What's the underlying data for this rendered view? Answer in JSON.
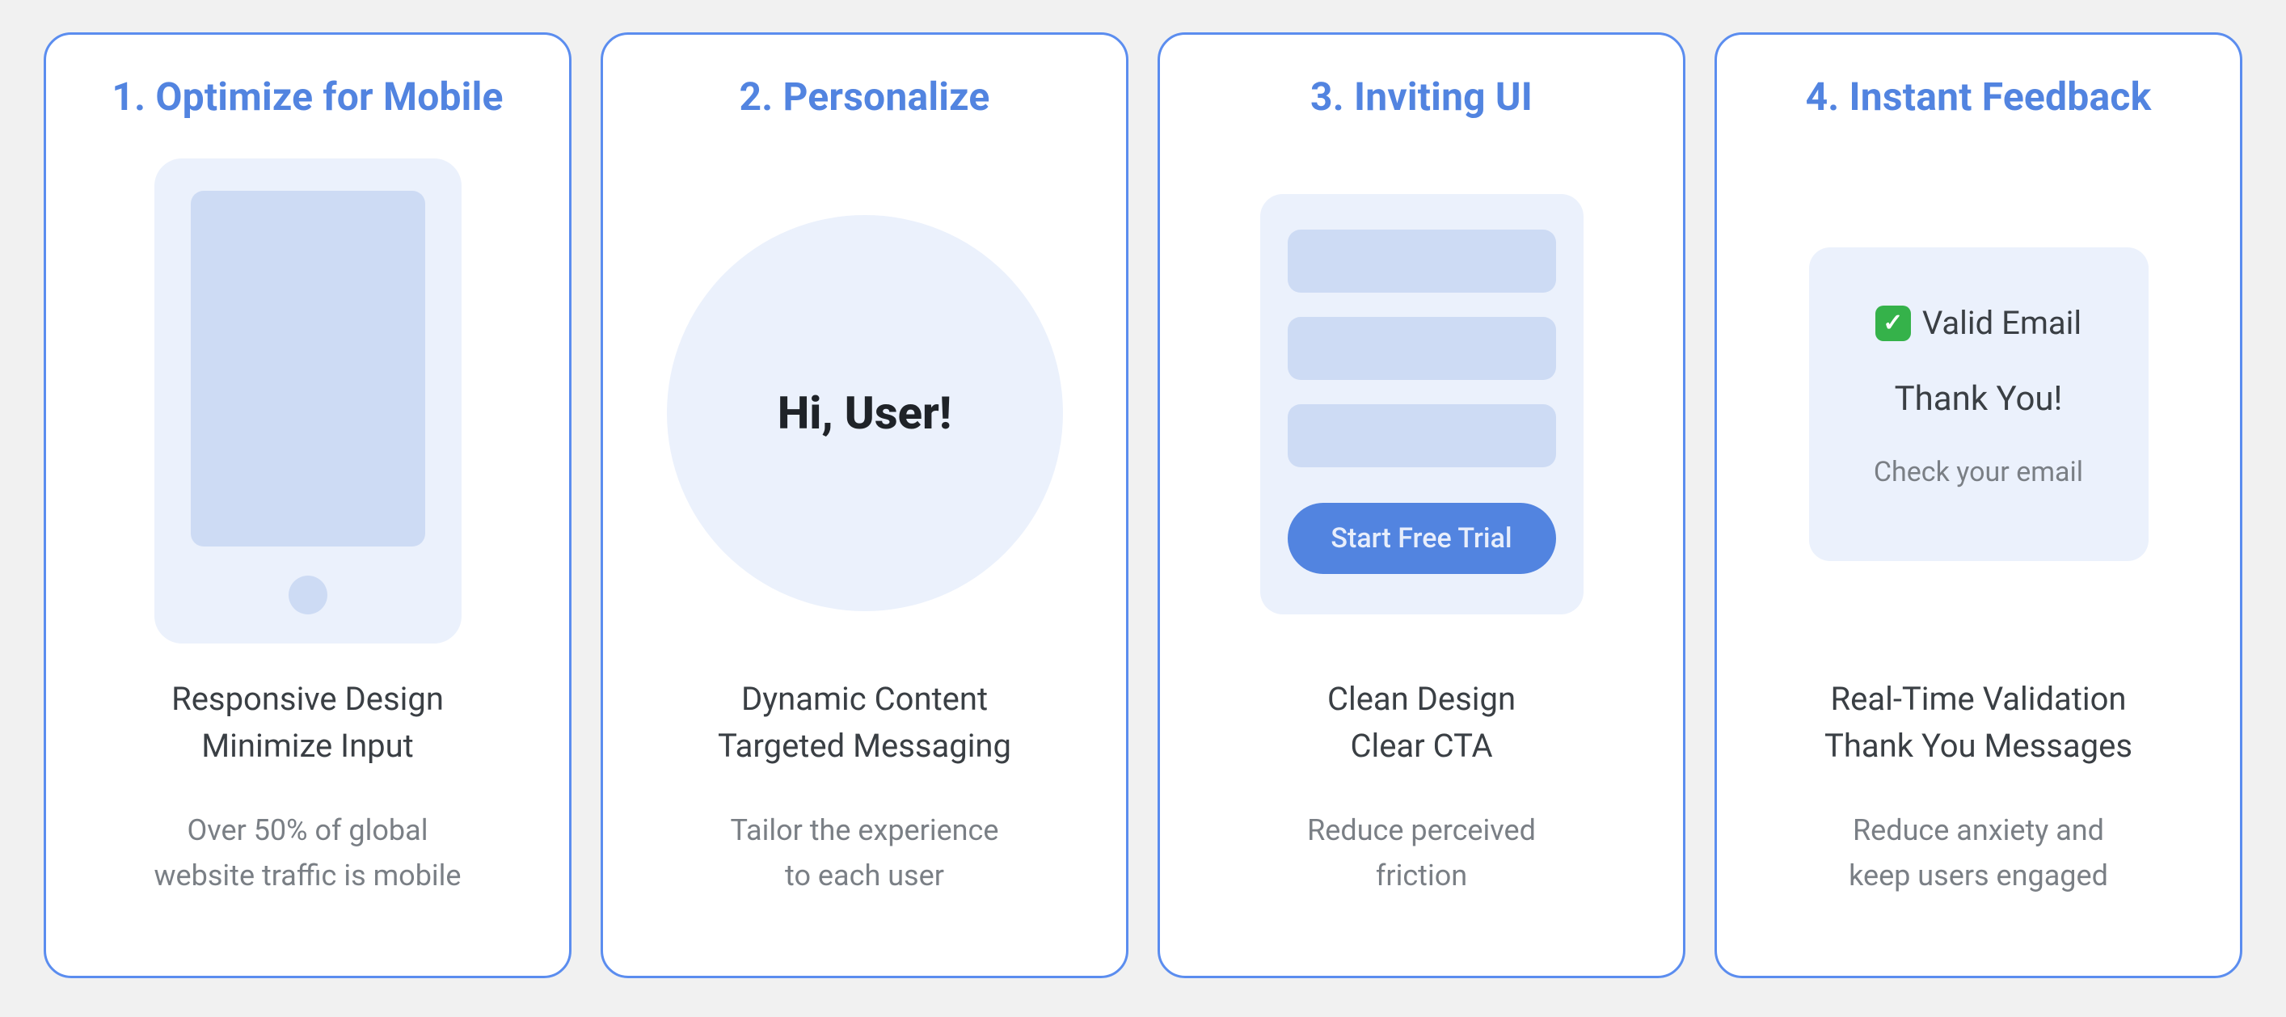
{
  "colors": {
    "bg": "#f1f1f1",
    "card_bg": "#ffffff",
    "card_border": "#5b8def",
    "title": "#5284e0",
    "soft": "#ebf1fc",
    "soft2": "#cddbf4",
    "accent": "#5284e0",
    "subtext": "#7a7f85",
    "ink": "#2b2f33",
    "check_bg": "#35b24a"
  },
  "cards": [
    {
      "title": "1. Optimize for Mobile",
      "bullet1": "Responsive Design",
      "bullet2": "Minimize Input",
      "caption1": "Over 50% of global",
      "caption2": "website traffic is mobile"
    },
    {
      "title": "2. Personalize",
      "greeting": "Hi, User!",
      "bullet1": "Dynamic Content",
      "bullet2": "Targeted Messaging",
      "caption1": "Tailor the experience",
      "caption2": "to each user"
    },
    {
      "title": "3. Inviting UI",
      "cta_label": "Start Free Trial",
      "bullet1": "Clean Design",
      "bullet2": "Clear CTA",
      "caption1": "Reduce perceived",
      "caption2": "friction"
    },
    {
      "title": "4. Instant Feedback",
      "valid_label": "Valid Email",
      "thanks": "Thank You!",
      "sub": "Check your email",
      "bullet1": "Real-Time Validation",
      "bullet2": "Thank You Messages",
      "caption1": "Reduce anxiety and",
      "caption2": "keep users engaged"
    }
  ]
}
